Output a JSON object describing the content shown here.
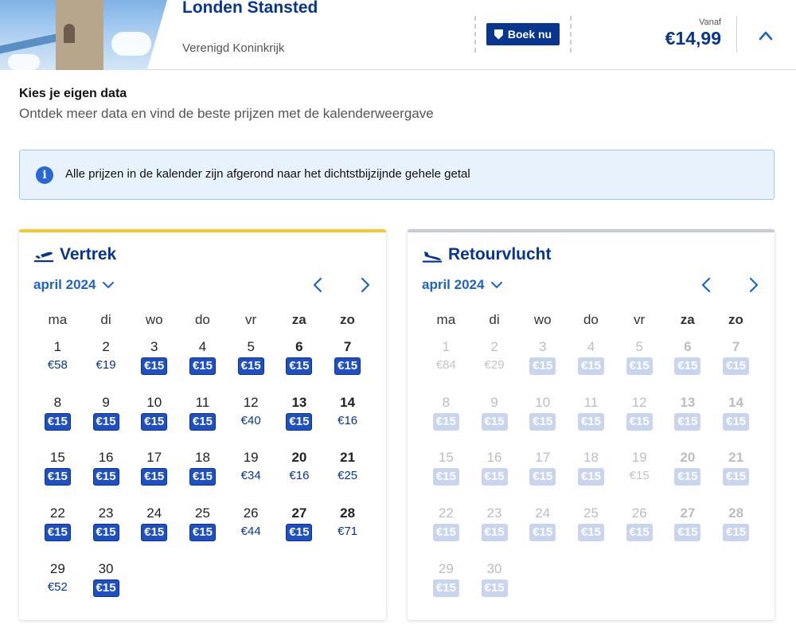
{
  "header": {
    "destination": "Londen Stansted",
    "country": "Verenigd Koninkrijk",
    "book_label": "Boek nu",
    "from_label": "Vanaf",
    "from_price": "€14,99"
  },
  "intro": {
    "title": "Kies je eigen data",
    "subtitle": "Ontdek meer data en vind de beste prijzen met de kalenderweergave"
  },
  "info": {
    "text": "Alle prijzen in de kalender zijn afgerond naar het dichtstbijzijnde gehele getal"
  },
  "weekdays": [
    "ma",
    "di",
    "wo",
    "do",
    "vr",
    "za",
    "zo"
  ],
  "outbound": {
    "title": "Vertrek",
    "month": "april 2024",
    "days": [
      {
        "d": "1",
        "p": "€58",
        "low": false
      },
      {
        "d": "2",
        "p": "€19",
        "low": false
      },
      {
        "d": "3",
        "p": "€15",
        "low": true
      },
      {
        "d": "4",
        "p": "€15",
        "low": true
      },
      {
        "d": "5",
        "p": "€15",
        "low": true
      },
      {
        "d": "6",
        "p": "€15",
        "low": true
      },
      {
        "d": "7",
        "p": "€15",
        "low": true
      },
      {
        "d": "8",
        "p": "€15",
        "low": true
      },
      {
        "d": "9",
        "p": "€15",
        "low": true
      },
      {
        "d": "10",
        "p": "€15",
        "low": true
      },
      {
        "d": "11",
        "p": "€15",
        "low": true
      },
      {
        "d": "12",
        "p": "€40",
        "low": false
      },
      {
        "d": "13",
        "p": "€15",
        "low": true
      },
      {
        "d": "14",
        "p": "€16",
        "low": false
      },
      {
        "d": "15",
        "p": "€15",
        "low": true
      },
      {
        "d": "16",
        "p": "€15",
        "low": true
      },
      {
        "d": "17",
        "p": "€15",
        "low": true
      },
      {
        "d": "18",
        "p": "€15",
        "low": true
      },
      {
        "d": "19",
        "p": "€34",
        "low": false
      },
      {
        "d": "20",
        "p": "€16",
        "low": false
      },
      {
        "d": "21",
        "p": "€25",
        "low": false
      },
      {
        "d": "22",
        "p": "€15",
        "low": true
      },
      {
        "d": "23",
        "p": "€15",
        "low": true
      },
      {
        "d": "24",
        "p": "€15",
        "low": true
      },
      {
        "d": "25",
        "p": "€15",
        "low": true
      },
      {
        "d": "26",
        "p": "€44",
        "low": false
      },
      {
        "d": "27",
        "p": "€15",
        "low": true
      },
      {
        "d": "28",
        "p": "€71",
        "low": false
      },
      {
        "d": "29",
        "p": "€52",
        "low": false
      },
      {
        "d": "30",
        "p": "€15",
        "low": true
      }
    ]
  },
  "return": {
    "title": "Retourvlucht",
    "month": "april 2024",
    "days": [
      {
        "d": "1",
        "p": "€84",
        "low": false
      },
      {
        "d": "2",
        "p": "€29",
        "low": false
      },
      {
        "d": "3",
        "p": "€15",
        "low": true
      },
      {
        "d": "4",
        "p": "€15",
        "low": true
      },
      {
        "d": "5",
        "p": "€15",
        "low": true
      },
      {
        "d": "6",
        "p": "€15",
        "low": true
      },
      {
        "d": "7",
        "p": "€15",
        "low": true
      },
      {
        "d": "8",
        "p": "€15",
        "low": true
      },
      {
        "d": "9",
        "p": "€15",
        "low": true
      },
      {
        "d": "10",
        "p": "€15",
        "low": true
      },
      {
        "d": "11",
        "p": "€15",
        "low": true
      },
      {
        "d": "12",
        "p": "€15",
        "low": true
      },
      {
        "d": "13",
        "p": "€15",
        "low": true
      },
      {
        "d": "14",
        "p": "€15",
        "low": true
      },
      {
        "d": "15",
        "p": "€15",
        "low": true
      },
      {
        "d": "16",
        "p": "€15",
        "low": true
      },
      {
        "d": "17",
        "p": "€15",
        "low": true
      },
      {
        "d": "18",
        "p": "€15",
        "low": true
      },
      {
        "d": "19",
        "p": "€15",
        "low": false
      },
      {
        "d": "20",
        "p": "€15",
        "low": true
      },
      {
        "d": "21",
        "p": "€15",
        "low": true
      },
      {
        "d": "22",
        "p": "€15",
        "low": true
      },
      {
        "d": "23",
        "p": "€15",
        "low": true
      },
      {
        "d": "24",
        "p": "€15",
        "low": true
      },
      {
        "d": "25",
        "p": "€15",
        "low": true
      },
      {
        "d": "26",
        "p": "€15",
        "low": true
      },
      {
        "d": "27",
        "p": "€15",
        "low": true
      },
      {
        "d": "28",
        "p": "€15",
        "low": true
      },
      {
        "d": "29",
        "p": "€15",
        "low": true
      },
      {
        "d": "30",
        "p": "€15",
        "low": true
      }
    ]
  },
  "colors": {
    "brand": "#073590",
    "accent": "#1f63c8",
    "outbound_bar": "#f1c933",
    "return_bar": "#c8cbd0"
  },
  "icons": {
    "book": "shield-icon",
    "collapse": "chevron-up-icon",
    "info": "info-icon",
    "departure": "plane-departure-icon",
    "arrival": "plane-arrival-icon",
    "month": "chevron-down-icon",
    "prev": "chevron-left-icon",
    "next": "chevron-right-icon"
  }
}
